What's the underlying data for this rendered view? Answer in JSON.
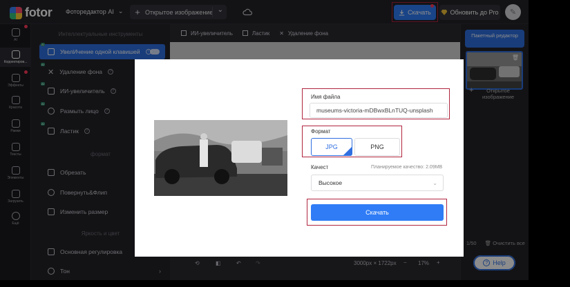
{
  "app": {
    "logo_text": "fotor",
    "editor_label": "Фоторедактор AI"
  },
  "topbar": {
    "open_image_label": "Открытое изображение",
    "download_label": "Скачать",
    "upgrade_label": "Обновить до Pro"
  },
  "rail": {
    "items": [
      {
        "label": "AI",
        "icon": "grid-icon"
      },
      {
        "label": "Корректиров...",
        "icon": "sliders-icon"
      },
      {
        "label": "Эффекты",
        "icon": "flask-icon"
      },
      {
        "label": "Красота",
        "icon": "eye-icon"
      },
      {
        "label": "Рамки",
        "icon": "frame-icon"
      },
      {
        "label": "Тексты",
        "icon": "text-icon"
      },
      {
        "label": "Элементы",
        "icon": "shapes-icon"
      },
      {
        "label": "Загрузить",
        "icon": "upload-icon"
      },
      {
        "label": "Ещё",
        "icon": "more-icon"
      }
    ]
  },
  "tools": {
    "section_ai": "Интеллектуальные инструменты",
    "ai_tools": [
      {
        "label": "УвелИчение одной клавишей",
        "active": true
      },
      {
        "label": "Удаление фона"
      },
      {
        "label": "ИИ-увеличитель"
      },
      {
        "label": "Размыть лицо"
      },
      {
        "label": "Ластик"
      }
    ],
    "section_format": "формат",
    "format_tools": [
      {
        "label": "Обрезать"
      },
      {
        "label": "Повернуть&Флип"
      },
      {
        "label": "Изменить размер"
      }
    ],
    "section_brightness": "Яркость и цвет",
    "brightness_tools": [
      {
        "label": "Основная регулировка"
      },
      {
        "label": "Тон"
      }
    ]
  },
  "canvas_toolbar": {
    "items": [
      {
        "label": "ИИ-увеличитель"
      },
      {
        "label": "Ластик"
      },
      {
        "label": "Удаление фона"
      }
    ]
  },
  "bottom_bar": {
    "dimensions": "3000px × 1722px",
    "zoom": "17%"
  },
  "right_panel": {
    "smart_editor": "Пакетный редактор",
    "add_image": "Открытое изображение",
    "count": "1/50",
    "clear_all": "Очистить все"
  },
  "help": {
    "label": "Help"
  },
  "modal": {
    "filename_label": "Имя файла",
    "filename_value": "museums-victoria-mDBwxBLnTUQ-unsplash",
    "format_label": "Формат",
    "format_options": [
      "JPG",
      "PNG"
    ],
    "format_selected": "JPG",
    "quality_label": "Качест",
    "planned_quality": "Планируемое качество: 2.09MB",
    "quality_value": "Высокое",
    "download_label": "Скачать"
  },
  "colors": {
    "accent": "#2f7cf6",
    "highlight_frame": "#b0243d"
  }
}
